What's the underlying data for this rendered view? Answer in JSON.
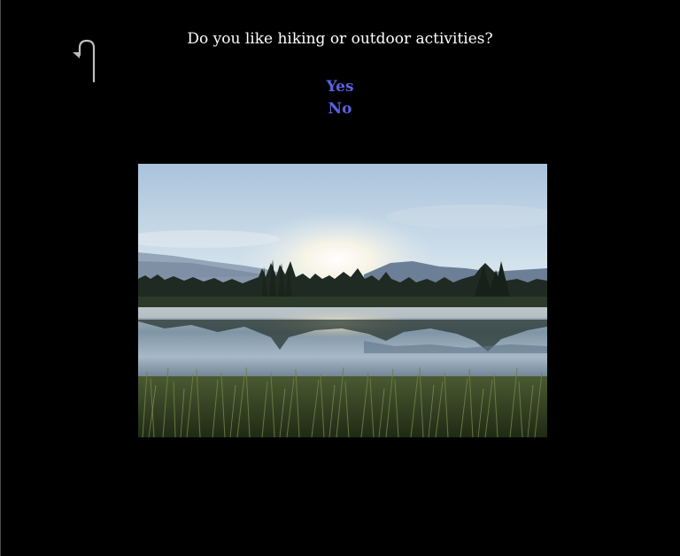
{
  "question": {
    "text": "Do you like hiking or outdoor activities?"
  },
  "options": [
    {
      "label": "Yes"
    },
    {
      "label": "No"
    }
  ],
  "icons": {
    "back": "return-arrow-icon"
  },
  "colors": {
    "background": "#000000",
    "question_text": "#ffffff",
    "option_link": "#5b63e0"
  }
}
